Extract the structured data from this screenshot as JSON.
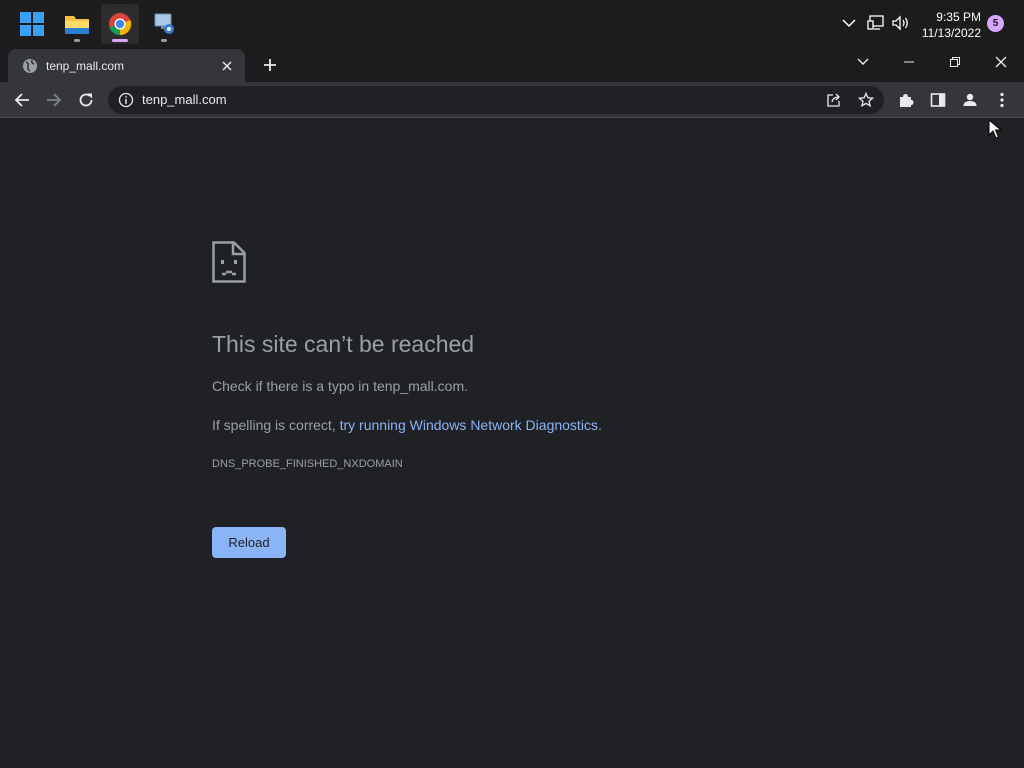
{
  "taskbar": {
    "apps": [
      {
        "name": "Start",
        "icon": "windows-logo-icon"
      },
      {
        "name": "File Explorer",
        "icon": "folder-icon"
      },
      {
        "name": "Google Chrome",
        "icon": "chrome-icon",
        "active": true
      },
      {
        "name": "Network Setup",
        "icon": "network-computer-icon"
      }
    ],
    "tray": {
      "icons": [
        "chevron-up-icon",
        "network-icon",
        "volume-icon"
      ],
      "time": "9:35 PM",
      "date": "11/13/2022",
      "notification_count": "5"
    }
  },
  "browser": {
    "tab": {
      "title": "tenp_mall.com",
      "favicon": "globe-icon"
    },
    "address": "tenp_mall.com"
  },
  "error": {
    "title": "This site can’t be reached",
    "line1": "Check if there is a typo in tenp_mall.com.",
    "line2_prefix": "If spelling is correct, ",
    "line2_link": "try running Windows Network Diagnostics",
    "line2_suffix": ".",
    "code": "DNS_PROBE_FINISHED_NXDOMAIN",
    "reload_label": "Reload"
  },
  "colors": {
    "page_bg": "#202124",
    "toolbar_bg": "#35363a",
    "link": "#8ab4f8",
    "button_bg": "#8ab4f8",
    "muted_text": "#9aa0a6"
  }
}
